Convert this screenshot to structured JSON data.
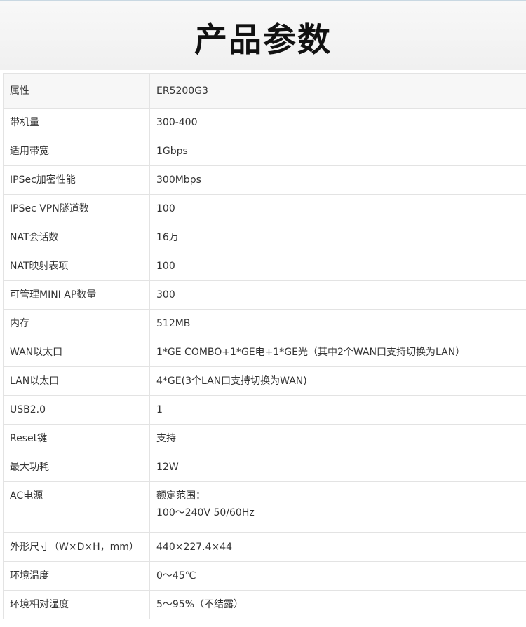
{
  "header": {
    "title": "产品参数"
  },
  "table": {
    "header": {
      "label": "属性",
      "value": "ER5200G3"
    },
    "rows": [
      {
        "label": "带机量",
        "value": "300-400"
      },
      {
        "label": "适用带宽",
        "value": "1Gbps"
      },
      {
        "label": "IPSec加密性能",
        "value": "300Mbps"
      },
      {
        "label": "IPSec VPN隧道数",
        "value": "100"
      },
      {
        "label": "NAT会话数",
        "value": "16万"
      },
      {
        "label": "NAT映射表项",
        "value": "100"
      },
      {
        "label": "可管理MINI AP数量",
        "value": "300"
      },
      {
        "label": "内存",
        "value": "512MB"
      },
      {
        "label": "WAN以太口",
        "value": "1*GE COMBO+1*GE电+1*GE光（其中2个WAN口支持切换为LAN）"
      },
      {
        "label": "LAN以太口",
        "value": "4*GE(3个LAN口支持切换为WAN)"
      },
      {
        "label": "USB2.0",
        "value": "1"
      },
      {
        "label": "Reset键",
        "value": "支持"
      },
      {
        "label": "最大功耗",
        "value": "12W"
      },
      {
        "label": "AC电源",
        "value_lines": [
          "额定范围：",
          "100～240V 50/60Hz"
        ]
      },
      {
        "label": "外形尺寸（W×D×H，mm）",
        "value": "440×227.4×44"
      },
      {
        "label": "环境温度",
        "value": "0～45℃"
      },
      {
        "label": "环境相对湿度",
        "value": "5～95%（不结露）"
      }
    ]
  }
}
